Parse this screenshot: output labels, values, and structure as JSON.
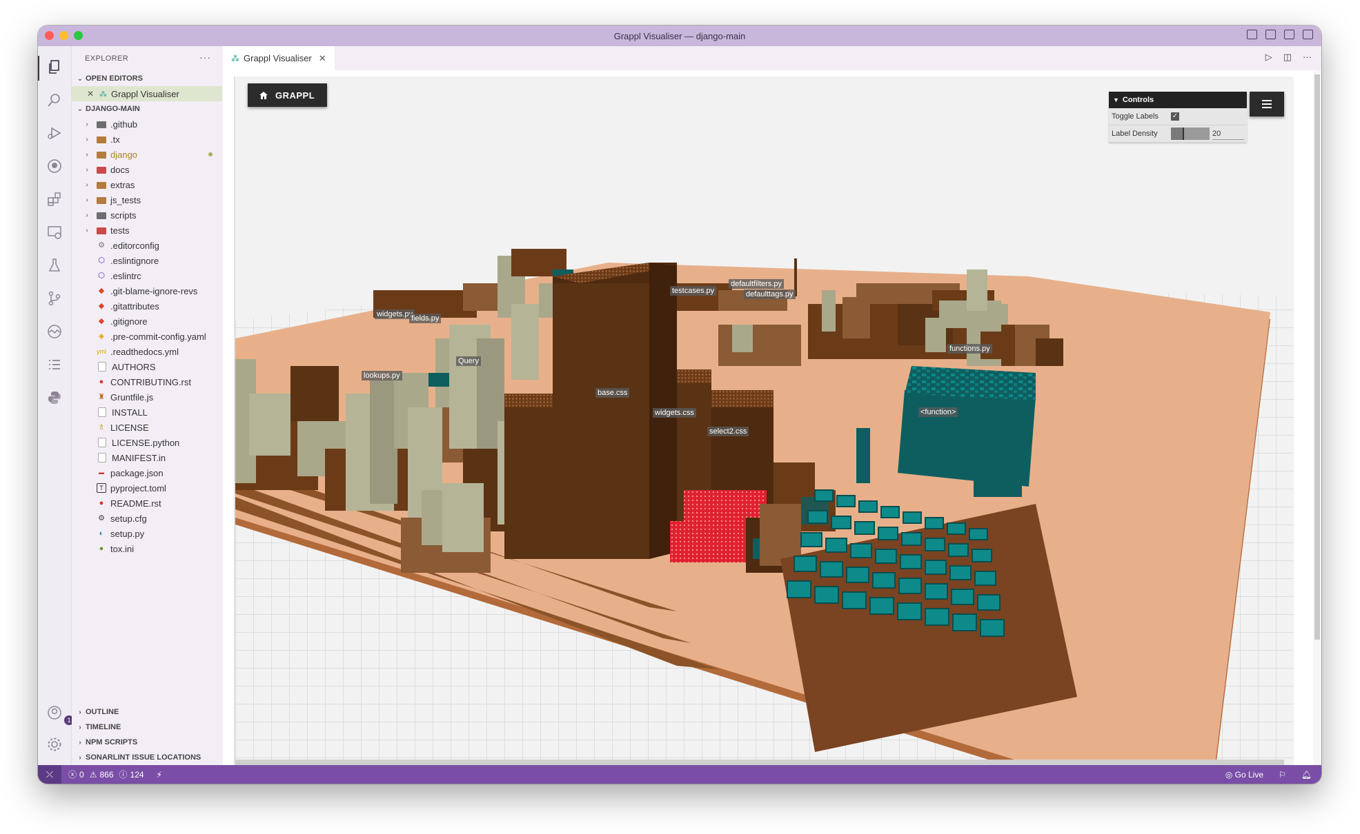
{
  "window": {
    "title": "Grappl Visualiser — django-main"
  },
  "activity_bar": {
    "account_badge": "1"
  },
  "explorer": {
    "title": "EXPLORER",
    "open_editors_label": "OPEN EDITORS",
    "open_editor_file": "Grappl Visualiser",
    "project_label": "DJANGO-MAIN",
    "folders": [
      ".github",
      ".tx",
      "django",
      "docs",
      "extras",
      "js_tests",
      "scripts",
      "tests"
    ],
    "files": [
      ".editorconfig",
      ".eslintignore",
      ".eslintrc",
      ".git-blame-ignore-revs",
      ".gitattributes",
      ".gitignore",
      ".pre-commit-config.yaml",
      ".readthedocs.yml",
      "AUTHORS",
      "CONTRIBUTING.rst",
      "Gruntfile.js",
      "INSTALL",
      "LICENSE",
      "LICENSE.python",
      "MANIFEST.in",
      "package.json",
      "pyproject.toml",
      "README.rst",
      "setup.cfg",
      "setup.py",
      "tox.ini"
    ],
    "bottom_sections": [
      "OUTLINE",
      "TIMELINE",
      "NPM SCRIPTS",
      "SONARLINT ISSUE LOCATIONS"
    ]
  },
  "editor": {
    "tab_label": "Grappl Visualiser"
  },
  "visualiser": {
    "home_button": "GRAPPL",
    "controls_title": "Controls",
    "toggle_labels_label": "Toggle Labels",
    "toggle_labels_checked": true,
    "label_density_label": "Label Density",
    "label_density_value": "20",
    "label_density_fraction": 0.3,
    "building_labels": {
      "widgets_py": "widgets.py",
      "fields_py": "fields.py",
      "query": "Query",
      "lookups_py": "lookups.py",
      "testcases_py": "testcases.py",
      "defaultfilters_py": "defaultfilters.py",
      "defaulttags_py": "defaulttags.py",
      "functions_py": "functions.py",
      "base_css": "base.css",
      "widgets_css": "widgets.css",
      "select2_css": "select2.css",
      "function": "<function>"
    }
  },
  "status_bar": {
    "errors": "0",
    "warnings": "866",
    "infos": "124",
    "go_live": "Go Live"
  },
  "colors": {
    "titlebar": "#c8b7da",
    "statusbar": "#7a4ea6",
    "building_brown": "#5a3214",
    "building_grey": "#a9a88b",
    "building_teal": "#0e5e5f",
    "ground": "#e8b08a",
    "red_block": "#e02030"
  }
}
